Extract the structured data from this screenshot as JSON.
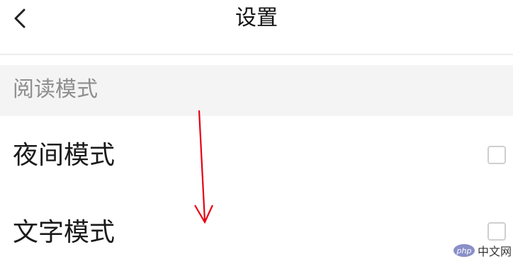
{
  "header": {
    "title": "设置",
    "back_icon": "chevron-left-icon"
  },
  "section": {
    "label": "阅读模式"
  },
  "rows": [
    {
      "label": "夜间模式",
      "checked": false
    },
    {
      "label": "文字模式",
      "checked": false
    }
  ],
  "annotation": {
    "arrow_color": "#e60012",
    "direction": "down"
  },
  "watermark": {
    "logo_text": "php",
    "text": "中文网"
  }
}
